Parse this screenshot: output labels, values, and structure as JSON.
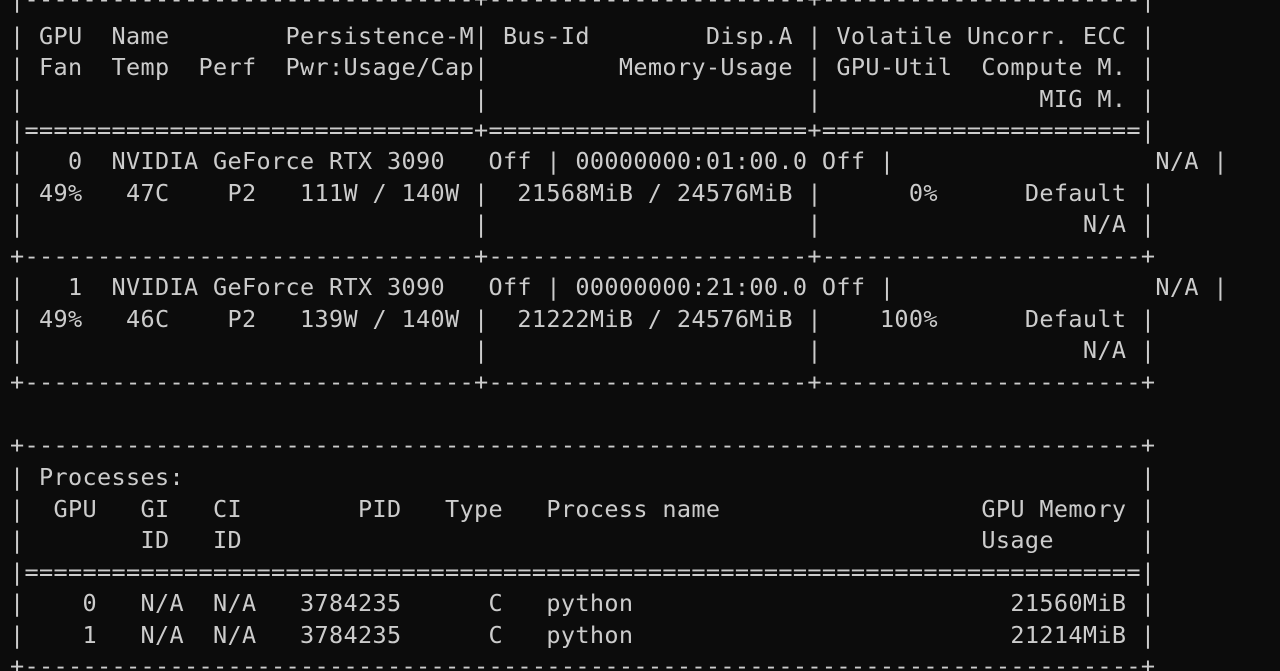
{
  "terminal": {
    "lines": [
      "|-------------------------------+----------------------+----------------------|",
      "| GPU  Name        Persistence-M| Bus-Id        Disp.A | Volatile Uncorr. ECC |",
      "| Fan  Temp  Perf  Pwr:Usage/Cap|         Memory-Usage | GPU-Util  Compute M. |",
      "|                               |                      |               MIG M. |",
      "|===============================+======================+======================|",
      "|   0  NVIDIA GeForce RTX 3090   Off | 00000000:01:00.0 Off |                  N/A |",
      "| 49%   47C    P2   111W / 140W |  21568MiB / 24576MiB |      0%      Default |",
      "|                               |                      |                  N/A |",
      "+-------------------------------+----------------------+----------------------+",
      "|   1  NVIDIA GeForce RTX 3090   Off | 00000000:21:00.0 Off |                  N/A |",
      "| 49%   46C    P2   139W / 140W |  21222MiB / 24576MiB |    100%      Default |",
      "|                               |                      |                  N/A |",
      "+-------------------------------+----------------------+----------------------+",
      "",
      "+-----------------------------------------------------------------------------+",
      "| Processes:                                                                  |",
      "|  GPU   GI   CI        PID   Type   Process name                  GPU Memory |",
      "|        ID   ID                                                   Usage      |",
      "|=============================================================================|",
      "|    0   N/A  N/A   3784235      C   python                          21560MiB |",
      "|    1   N/A  N/A   3784235      C   python                          21214MiB |",
      "+-----------------------------------------------------------------------------+"
    ]
  }
}
